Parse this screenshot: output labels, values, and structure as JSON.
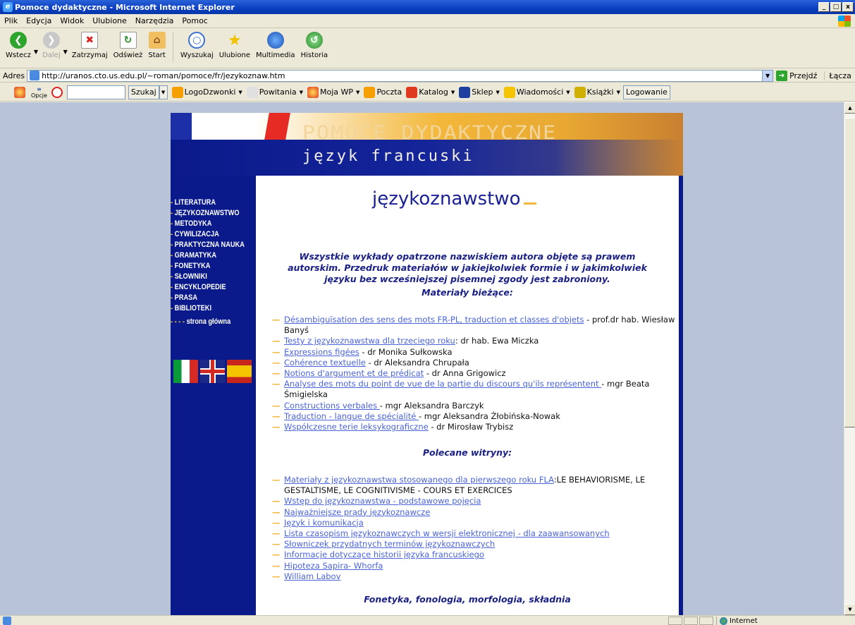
{
  "window": {
    "title": "Pomoce dydaktyczne - Microsoft Internet Explorer",
    "buttons": [
      "_",
      "□",
      "x"
    ]
  },
  "menu": [
    "Plik",
    "Edycja",
    "Widok",
    "Ulubione",
    "Narzędzia",
    "Pomoc"
  ],
  "toolbar": {
    "back": "Wstecz",
    "forward": "Dalej",
    "stop": "Zatrzymaj",
    "refresh": "Odśwież",
    "home": "Start",
    "search": "Wyszukaj",
    "favorites": "Ulubione",
    "media": "Multimedia",
    "history": "Historia"
  },
  "address": {
    "label": "Adres",
    "url": "http://uranos.cto.us.edu.pl/~roman/pomoce/fr/jezykoznaw.htm",
    "go": "Przejdź",
    "links": "Łącza"
  },
  "wpbar": {
    "options": "Opcje",
    "search_button": "Szukaj",
    "items": [
      "LogoDzwonki",
      "Powitania",
      "Moja WP",
      "Poczta",
      "Katalog",
      "Sklep",
      "Wiadomości",
      "Książki"
    ],
    "login": "Logowanie"
  },
  "status": {
    "zone": "Internet"
  },
  "banner": {
    "line1": "POMOCE DYDAKTYCZNE",
    "line2": "język francuski"
  },
  "sidebar": {
    "items": [
      "LITERATURA",
      "JĘZYKOZNAWSTWO",
      "METODYKA",
      "CYWILIZACJA",
      "PRAKTYCZNA NAUKA",
      "GRAMATYKA",
      "FONETYKA",
      "SŁOWNIKI",
      "ENCYKLOPEDIE",
      "PRASA",
      "BIBLIOTEKI"
    ],
    "dash": "-",
    "home_dashes": "- - - -",
    "home": "strona główna"
  },
  "main": {
    "heading": "językoznawstwo",
    "notice": "Wszystkie wykłady opatrzone nazwiskiem autora objęte są prawem autorskim. Przedruk materiałów w jakiejkolwiek formie i w jakimkolwiek języku bez wcześniejszej pisemnej zgody jest zabroniony.",
    "section1": "Materiały bieżące:",
    "section2": "Polecane witryny:",
    "section3": "Fonetyka, fonologia, morfologia, składnia",
    "current": [
      {
        "link": "Désambiguïsation des sens des mots FR-PL, traduction et classes d'objets",
        "after": " - prof.dr hab. Wiesław Banyś"
      },
      {
        "link": "Testy z językoznawstwa dla trzeciego roku",
        "after": ": dr hab. Ewa Miczka"
      },
      {
        "link": "Expressions figées",
        "after": " - dr Monika Sułkowska"
      },
      {
        "link": "Cohérence textuelle",
        "after": " - dr Aleksandra Chrupała"
      },
      {
        "link": "Notions d'argument et de prédicat",
        "after": " - dr Anna Grigowicz"
      },
      {
        "link": "Analyse des mots du point de vue de la partie du discours qu'ils représentent ",
        "after": "- mgr Beata Śmigielska"
      },
      {
        "link": "Constructions verbales ",
        "after": "- mgr Aleksandra Barczyk"
      },
      {
        "link": "Traduction - langue de spécialité ",
        "after": "- mgr Aleksandra Żłobińska-Nowak"
      },
      {
        "link": "Współczesne terie leksykograficzne",
        "after": " - dr Mirosław Trybisz"
      }
    ],
    "recommended": [
      {
        "link": "Materiały z językoznawstwa stosowanego dla pierwszego roku FLA",
        "after": ":LE BEHAVIORISME, LE GESTALTISME, LE COGNITIVISME - COURS ET EXERCICES"
      },
      {
        "link": "Wstęp do językoznawstwa - podstawowe pojęcia",
        "after": ""
      },
      {
        "link": "Najważniejsze prądy językoznawcze",
        "after": ""
      },
      {
        "link": "Język i komunikacja",
        "after": ""
      },
      {
        "link": "Lista czasopism językoznawczych w wersji elektronicznej - dla zaawansowanych",
        "after": ""
      },
      {
        "link": "Słowniczek przydatnych terminów językoznawczych",
        "after": ""
      },
      {
        "link": "Informacje dotyczące historii języka francuskiego",
        "after": ""
      },
      {
        "link": "Hipoteza Sapira- Whorfa",
        "after": ""
      },
      {
        "link": "William Labov",
        "after": ""
      }
    ]
  }
}
